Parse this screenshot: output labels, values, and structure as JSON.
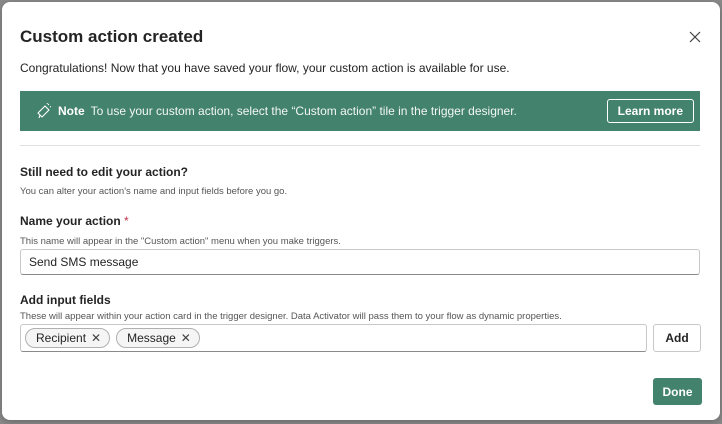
{
  "dialog": {
    "title": "Custom action created",
    "subtitle": "Congratulations! Now that you have saved your flow, your custom action is available for use.",
    "close_icon": "close-icon"
  },
  "note": {
    "icon": "megaphone-icon",
    "label": "Note",
    "text": "To use your custom action, select the “Custom action” tile in the trigger designer.",
    "learn_more_label": "Learn more",
    "color": "#43826c"
  },
  "edit_section": {
    "heading": "Still need to edit your action?",
    "description": "You can alter your action's name and input fields before you go."
  },
  "name_section": {
    "heading": "Name your action",
    "required_marker": "*",
    "description": "This name will appear in the \"Custom action\" menu when you make triggers.",
    "value": "Send SMS message"
  },
  "input_fields_section": {
    "heading": "Add input fields",
    "description": "These will appear within your action card in the trigger designer.  Data Activator will pass them to your flow as dynamic properties.",
    "tags": [
      {
        "label": "Recipient",
        "remove": "✕"
      },
      {
        "label": "Message",
        "remove": "✕"
      }
    ],
    "add_label": "Add"
  },
  "footer": {
    "done_label": "Done"
  },
  "colors": {
    "accent": "#43826c",
    "required": "#c4314b"
  }
}
